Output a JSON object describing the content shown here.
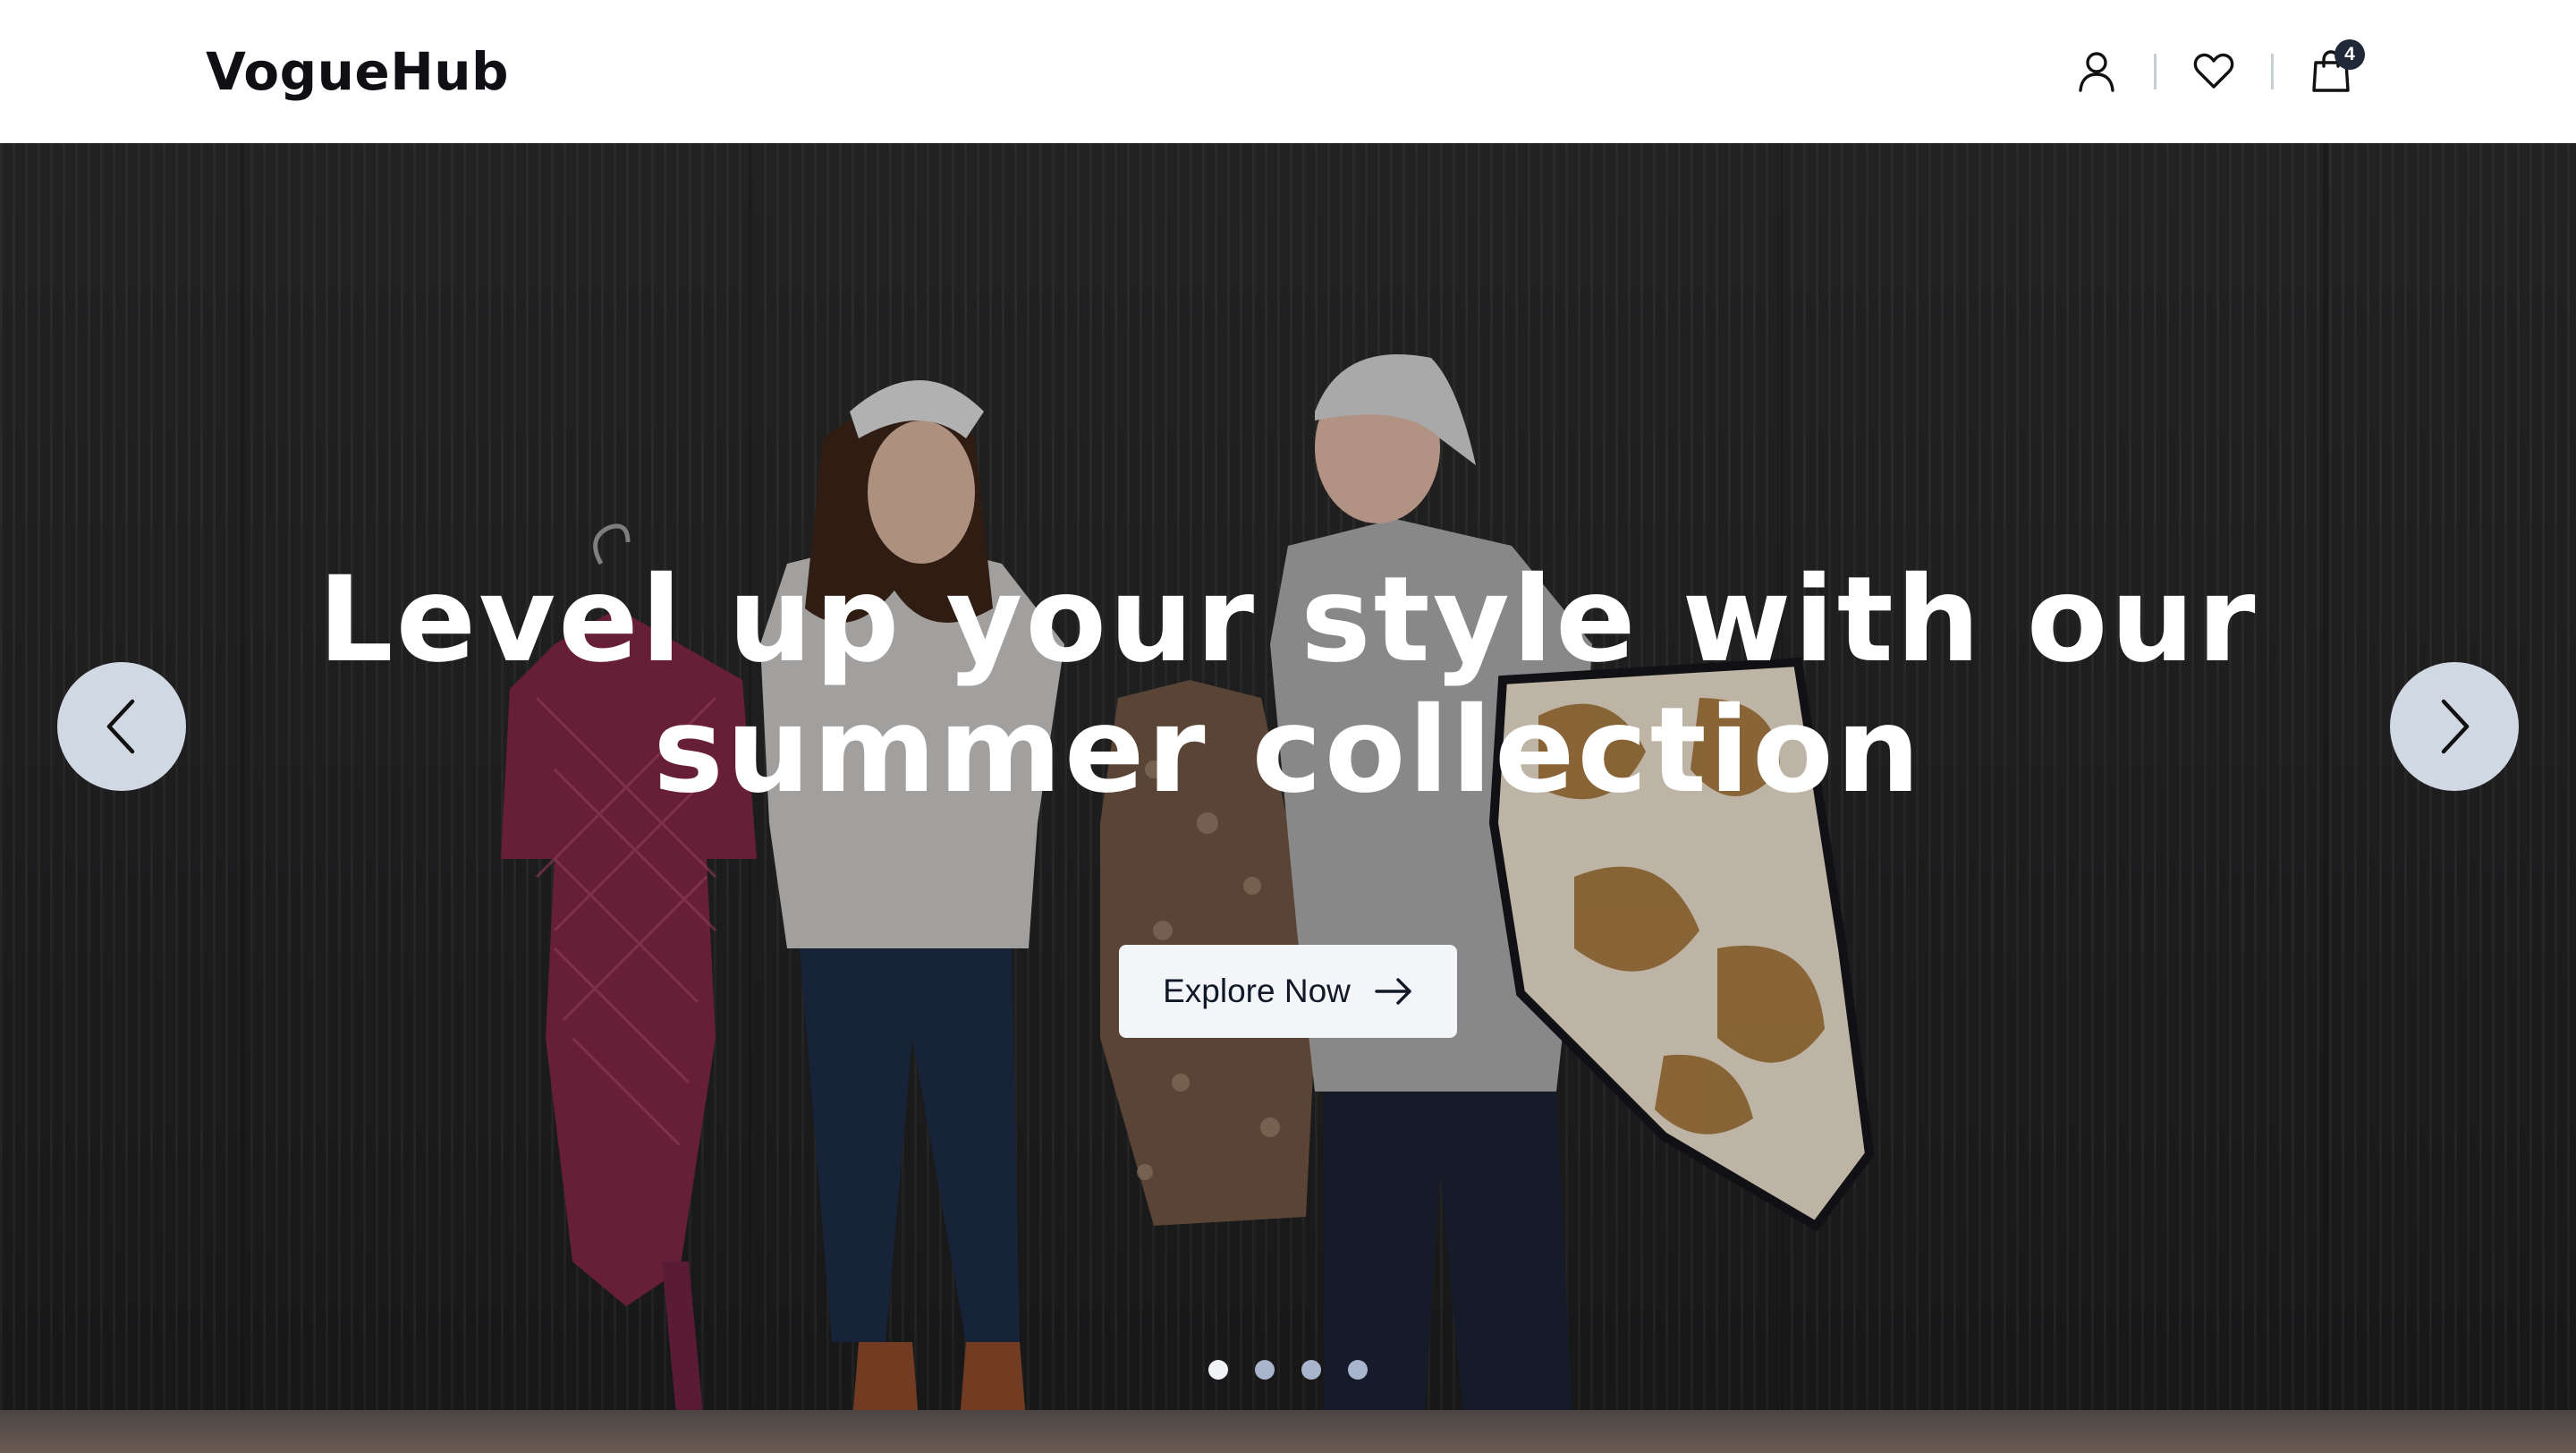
{
  "header": {
    "logo": "VogueHub",
    "icons": {
      "account": "user-icon",
      "wishlist": "heart-icon",
      "cart": "shopping-bag-icon"
    },
    "cart_count": "4"
  },
  "hero": {
    "title": "Level up your style with our summer collection",
    "cta_label": "Explore Now",
    "cta_icon": "arrow-right-icon",
    "prev_icon": "chevron-left-icon",
    "next_icon": "chevron-right-icon",
    "slides_total": 4,
    "active_slide": 1
  },
  "colors": {
    "header_bg": "#ffffff",
    "logo": "#0f0f14",
    "badge_bg": "#1f2937",
    "cta_bg": "#f3f5f8",
    "arrow_bg": "#d0d8e4",
    "dot_active": "#f1f3f6",
    "dot_inactive": "#a9b5cc"
  }
}
